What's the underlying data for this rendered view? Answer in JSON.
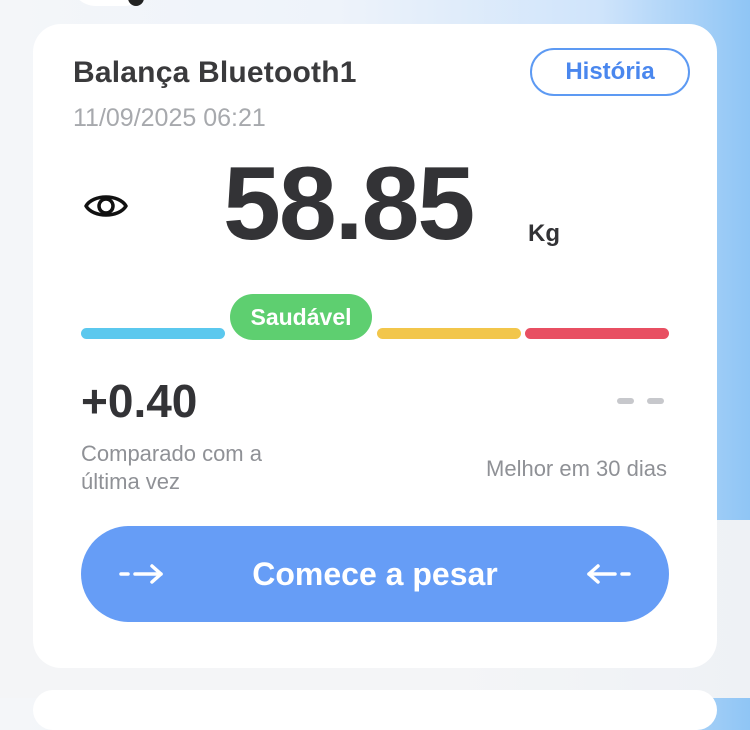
{
  "card": {
    "device_name": "Balança Bluetooth1",
    "timestamp": "11/09/2025 06:21",
    "history_label": "História"
  },
  "measurement": {
    "weight": "58.85",
    "unit": "Kg",
    "status": "Saudável"
  },
  "indicator": {
    "colors": [
      "#5bc8ee",
      "#5ecf70",
      "#f2c64b",
      "#e84f62"
    ],
    "active_segment": 2
  },
  "comparison": {
    "delta": "+0.40",
    "delta_caption": "Comparado com a última vez",
    "best_value": "- -",
    "best_caption": "Melhor em 30 dias"
  },
  "action": {
    "start_label": "Comece a pesar"
  },
  "colors": {
    "accent": "#669df6",
    "healthy": "#5ecf70"
  }
}
